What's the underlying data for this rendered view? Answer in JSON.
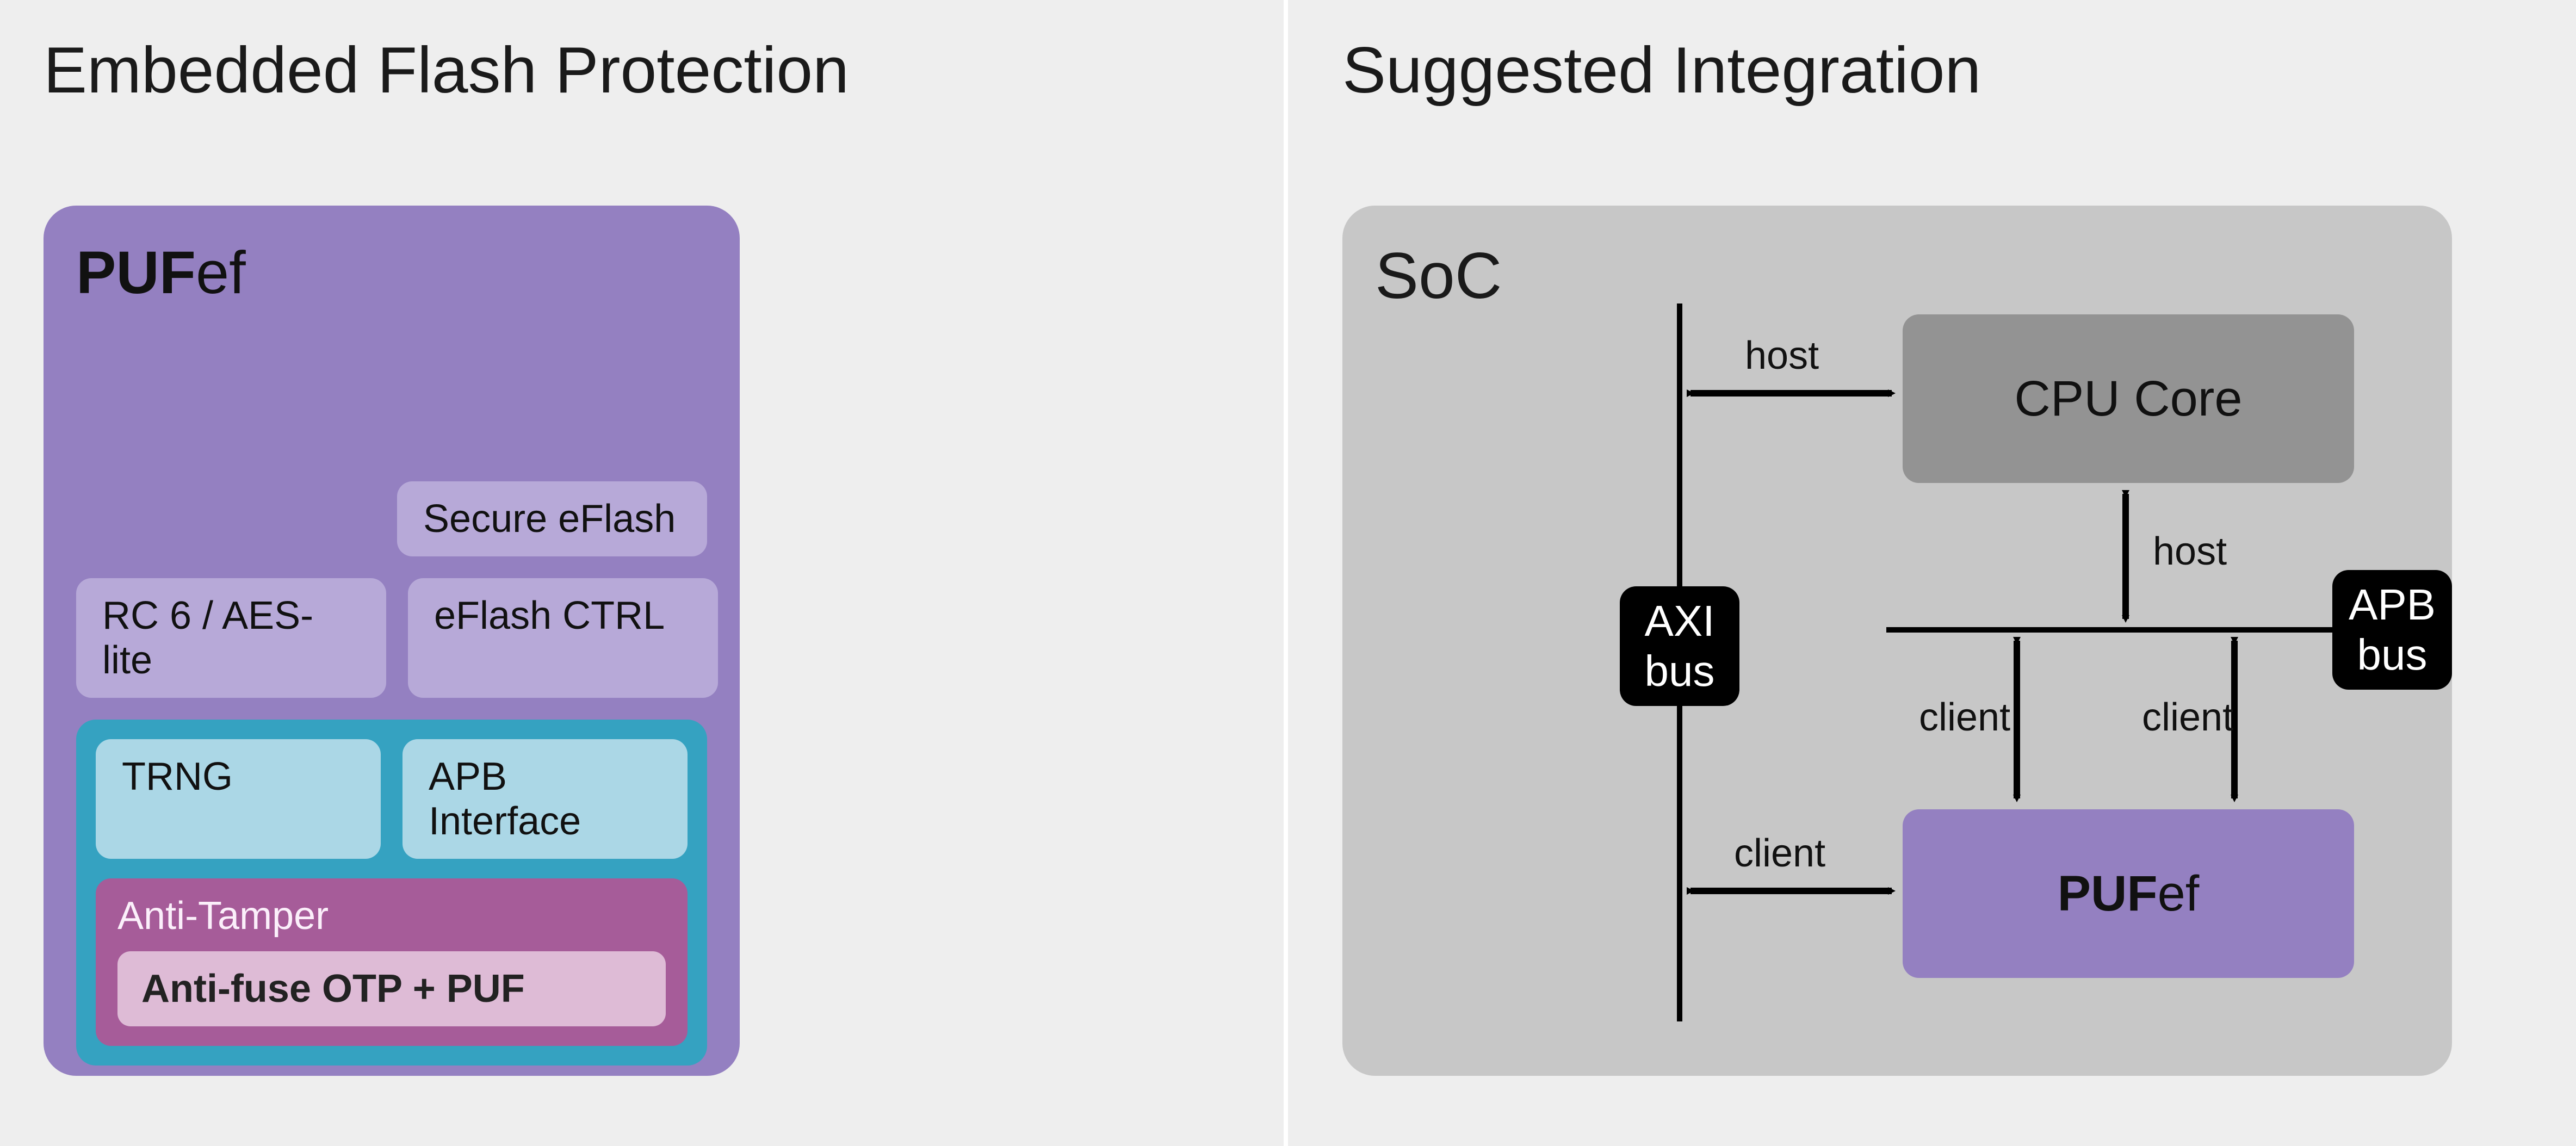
{
  "left": {
    "title": "Embedded Flash Protection",
    "box_title_bold": "PUF",
    "box_title_rest": "ef",
    "secure_eflash": "Secure eFlash",
    "rc6": "RC 6 / AES-lite",
    "eflash_ctrl": "eFlash CTRL",
    "trng": "TRNG",
    "apb_if": "APB Interface",
    "anti_tamper": "Anti-Tamper",
    "anti_fuse": "Anti-fuse OTP + PUF"
  },
  "right": {
    "title": "Suggested Integration",
    "soc": "SoC",
    "cpu": "CPU Core",
    "pufef_bold": "PUF",
    "pufef_rest": "ef",
    "axi_bus_l1": "AXI",
    "axi_bus_l2": "bus",
    "apb_bus_l1": "APB",
    "apb_bus_l2": "bus",
    "host": "host",
    "client": "client"
  }
}
